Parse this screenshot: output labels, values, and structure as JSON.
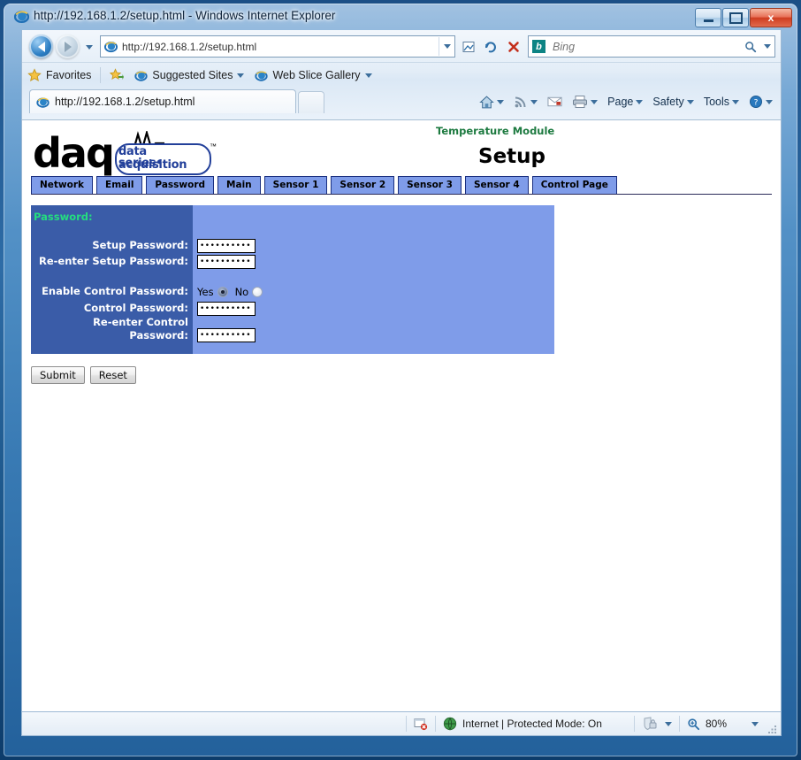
{
  "window": {
    "title": "http://192.168.1.2/setup.html - Windows Internet Explorer",
    "minimize_label": "Minimize",
    "maximize_label": "Maximize",
    "close_label": "x"
  },
  "toolbar": {
    "address_value": "http://192.168.1.2/setup.html",
    "search_placeholder": "Bing",
    "search_value": "",
    "bing_glyph": "b",
    "back_name": "back-button",
    "forward_name": "forward-button"
  },
  "favorites": {
    "label": "Favorites",
    "items": [
      {
        "label": "Suggested Sites"
      },
      {
        "label": "Web Slice Gallery"
      }
    ]
  },
  "tabs": {
    "active_label": "http://192.168.1.2/setup.html"
  },
  "command_bar": {
    "items": [
      {
        "label": ""
      },
      {
        "label": ""
      },
      {
        "label": ""
      },
      {
        "label": ""
      },
      {
        "label": "Page"
      },
      {
        "label": "Safety"
      },
      {
        "label": "Tools"
      },
      {
        "label": ""
      }
    ],
    "page_label": "Page",
    "safety_label": "Safety",
    "tools_label": "Tools"
  },
  "page": {
    "logo": {
      "wordmark": "daq",
      "sub_line1": "data acquisition",
      "sub_line2": "series•",
      "trademark": "™"
    },
    "module_title": "Temperature Module",
    "page_title": "Setup",
    "nav_tabs": [
      {
        "label": "Network"
      },
      {
        "label": "Email"
      },
      {
        "label": "Password"
      },
      {
        "label": "Main"
      },
      {
        "label": "Sensor 1"
      },
      {
        "label": "Sensor 2"
      },
      {
        "label": "Sensor 3"
      },
      {
        "label": "Sensor 4"
      },
      {
        "label": "Control Page"
      }
    ],
    "form": {
      "section_heading": "Password:",
      "fields": [
        {
          "label": "Setup Password:",
          "type": "password",
          "value": "••••••••••"
        },
        {
          "label": "Re-enter Setup Password:",
          "type": "password",
          "value": "••••••••••"
        },
        {
          "label": "Enable Control Password:",
          "type": "radio",
          "yes_label": "Yes",
          "no_label": "No",
          "selected": "Yes"
        },
        {
          "label": "Control Password:",
          "type": "password",
          "value": "••••••••••"
        },
        {
          "label": "Re-enter Control Password:",
          "label_line1": "Re-enter Control",
          "label_line2": "Password:",
          "type": "password",
          "value": "••••••••••"
        }
      ],
      "submit_label": "Submit",
      "reset_label": "Reset"
    },
    "colors": {
      "panel_dark": "#3a5ca8",
      "panel_light": "#7f9ce9",
      "heading_green": "#24dd7f",
      "module_green": "#1d7a40",
      "logo_blue": "#23409a"
    }
  },
  "statusbar": {
    "zone_text": "Internet | Protected Mode: On",
    "zoom_level": "80%"
  }
}
